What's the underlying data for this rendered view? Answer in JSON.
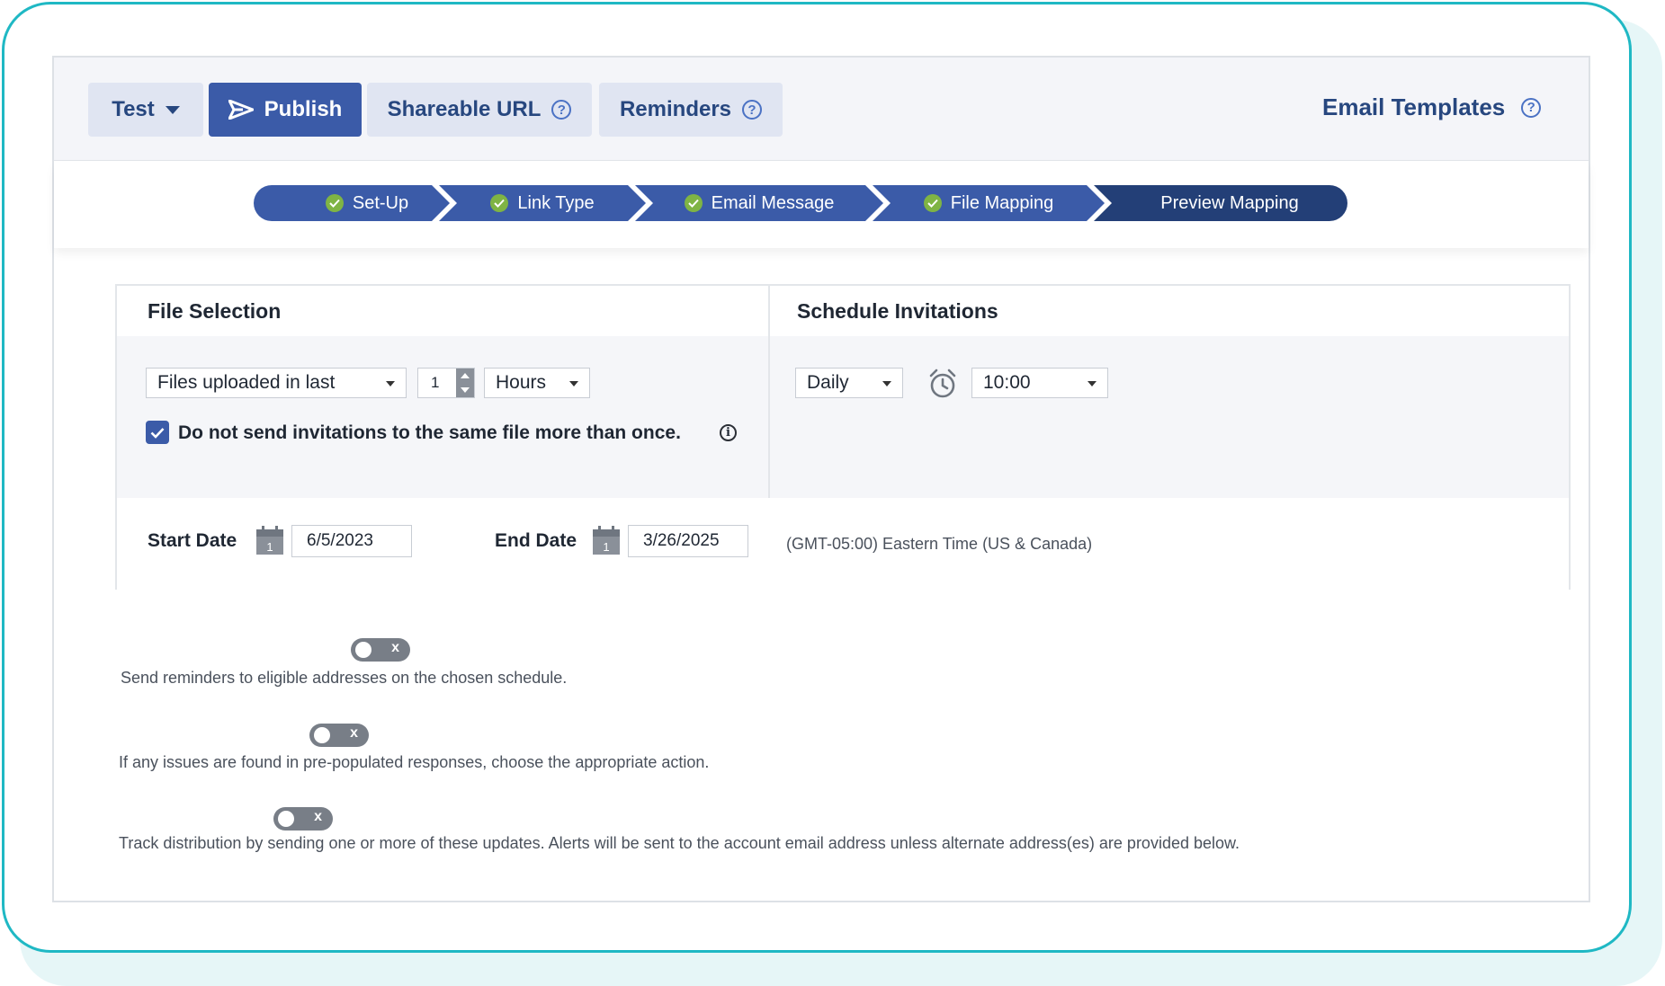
{
  "toolbar": {
    "test_label": "Test",
    "publish_label": "Publish",
    "shareable_url_label": "Shareable URL",
    "reminders_label": "Reminders",
    "email_templates_label": "Email Templates",
    "help_glyph": "?"
  },
  "stepper": {
    "steps": [
      {
        "label": "Set-Up",
        "completed": true
      },
      {
        "label": "Link Type",
        "completed": true
      },
      {
        "label": "Email Message",
        "completed": true
      },
      {
        "label": "File Mapping",
        "completed": true
      },
      {
        "label": "Preview Mapping",
        "completed": false,
        "active": true
      }
    ],
    "colors": {
      "step": "#3b5ba8",
      "active": "#233f77",
      "check": "#7fb444"
    }
  },
  "file_selection": {
    "title": "File Selection",
    "filter_value": "Files uploaded in last",
    "count_value": "1",
    "unit_value": "Hours",
    "no_duplicate_label": "Do not send invitations to the same file more than once.",
    "no_duplicate_checked": true,
    "info_glyph": "i"
  },
  "schedule": {
    "title": "Schedule Invitations",
    "frequency_value": "Daily",
    "time_value": "10:00"
  },
  "dates": {
    "start_label": "Start Date",
    "start_value": "6/5/2023",
    "end_label": "End Date",
    "end_value": "3/26/2025",
    "calendar_day": "1",
    "timezone": "(GMT-05:00) Eastern Time (US & Canada)"
  },
  "options": [
    {
      "toggle_glyph": "x",
      "on": false,
      "text": "Send reminders to eligible addresses on the chosen schedule."
    },
    {
      "toggle_glyph": "x",
      "on": false,
      "text": "If any issues are found in pre-populated responses, choose the appropriate action."
    },
    {
      "toggle_glyph": "x",
      "on": false,
      "text": "Track distribution by sending one or more of these updates. Alerts will be sent to the account email address unless alternate address(es) are provided below."
    }
  ],
  "icons": [
    "caret-down-icon",
    "send-icon",
    "help-icon",
    "check-icon",
    "clock-icon",
    "calendar-icon",
    "info-icon"
  ]
}
